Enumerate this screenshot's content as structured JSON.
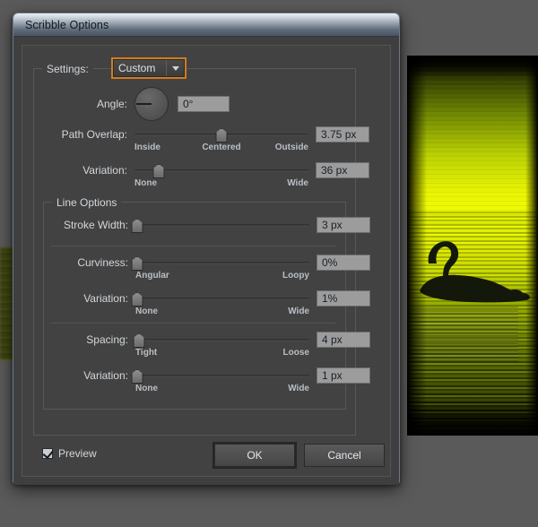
{
  "window": {
    "title": "Scribble Options"
  },
  "settings": {
    "label": "Settings:",
    "value": "Custom",
    "dropdown_icon": "chevron-down-icon"
  },
  "angle": {
    "label": "Angle:",
    "value": "0°",
    "dial_icon": "angle-dial"
  },
  "path_overlap": {
    "label": "Path Overlap:",
    "value": "3.75 px",
    "scale_min": "Inside",
    "scale_mid": "Centered",
    "scale_max": "Outside",
    "thumb_percent": 50
  },
  "path_overlap_variation": {
    "label": "Variation:",
    "value": "36 px",
    "scale_min": "None",
    "scale_max": "Wide",
    "thumb_percent": 14
  },
  "line_options": {
    "title": "Line Options",
    "stroke_width": {
      "label": "Stroke Width:",
      "value": "3 px",
      "thumb_percent": 1
    },
    "curviness": {
      "label": "Curviness:",
      "value": "0%",
      "scale_min": "Angular",
      "scale_max": "Loopy",
      "thumb_percent": 1
    },
    "curviness_variation": {
      "label": "Variation:",
      "value": "1%",
      "scale_min": "None",
      "scale_max": "Wide",
      "thumb_percent": 1
    },
    "spacing": {
      "label": "Spacing:",
      "value": "4 px",
      "scale_min": "Tight",
      "scale_max": "Loose",
      "thumb_percent": 2
    },
    "spacing_variation": {
      "label": "Variation:",
      "value": "1 px",
      "scale_min": "None",
      "scale_max": "Wide",
      "thumb_percent": 1
    }
  },
  "footer": {
    "preview_label": "Preview",
    "preview_checked": true,
    "ok_label": "OK",
    "cancel_label": "Cancel"
  },
  "colors": {
    "accent_focus": "#d27b20",
    "panel_bg": "#424242",
    "desktop_bg": "#5a5a5a",
    "artwork_highlight": "#f2ff00"
  }
}
